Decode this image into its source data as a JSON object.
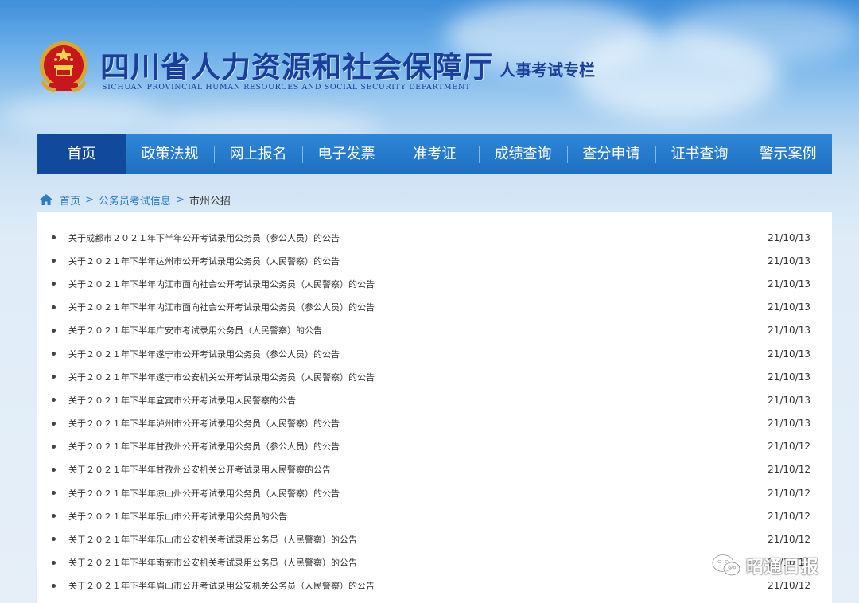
{
  "header": {
    "title": "四川省人力资源和社会保障厅",
    "subtitle": "SICHUAN PROVINCIAL HUMAN RESOURCES AND SOCIAL SECURITY DEPARTMENT",
    "section": "人事考试专栏",
    "emblem_icon": "national-emblem-icon"
  },
  "nav": {
    "items": [
      {
        "label": "首页"
      },
      {
        "label": "政策法规"
      },
      {
        "label": "网上报名"
      },
      {
        "label": "电子发票"
      },
      {
        "label": "准考证"
      },
      {
        "label": "成绩查询"
      },
      {
        "label": "查分申请"
      },
      {
        "label": "证书查询"
      },
      {
        "label": "警示案例"
      }
    ],
    "active_index": 0
  },
  "breadcrumb": {
    "home": "首页",
    "sep": ">",
    "parent": "公务员考试信息",
    "current": "市州公招"
  },
  "list": {
    "items": [
      {
        "title": "关于成都市２０２１年下半年公开考试录用公务员（参公人员）的公告",
        "date": "21/10/13"
      },
      {
        "title": "关于２０２１年下半年达州市公开考试录用公务员（人民警察）的公告",
        "date": "21/10/13"
      },
      {
        "title": "关于２０２１年下半年内江市面向社会公开考试录用公务员（人民警察）的公告",
        "date": "21/10/13"
      },
      {
        "title": "关于２０２１年下半年内江市面向社会公开考试录用公务员（参公人员）的公告",
        "date": "21/10/13"
      },
      {
        "title": "关于２０２１年下半年广安市考试录用公务员（人民警察）的公告",
        "date": "21/10/13"
      },
      {
        "title": "关于２０２１年下半年遂宁市公开考试录用公务员（参公人员）的公告",
        "date": "21/10/13"
      },
      {
        "title": "关于２０２１年下半年遂宁市公安机关公开考试录用公务员（人民警察）的公告",
        "date": "21/10/13"
      },
      {
        "title": "关于２０２１年下半年宜宾市公开考试录用人民警察的公告",
        "date": "21/10/13"
      },
      {
        "title": "关于２０２１年下半年泸州市公开考试录用公务员（人民警察）的公告",
        "date": "21/10/13"
      },
      {
        "title": "关于２０２１年下半年甘孜州公开考试录用公务员（参公人员）的公告",
        "date": "21/10/12"
      },
      {
        "title": "关于２０２１年下半年甘孜州公安机关公开考试录用人民警察的公告",
        "date": "21/10/12"
      },
      {
        "title": "关于２０２１年下半年凉山州公开考试录用公务员（人民警察）的公告",
        "date": "21/10/12"
      },
      {
        "title": "关于２０２１年下半年乐山市公开考试录用公务员的公告",
        "date": "21/10/12"
      },
      {
        "title": "关于２０２１年下半年乐山市公安机关考试录用公务员（人民警察）的公告",
        "date": "21/10/12"
      },
      {
        "title": "关于２０２１年下半年南充市公安机关考试录用公务员（人民警察）的公告",
        "date": "21/10/12"
      },
      {
        "title": "关于２０２１年下半年眉山市公开考试录用公安机关公务员（人民警察）的公告",
        "date": "21/10/12"
      }
    ]
  },
  "watermark": {
    "text": "昭通日报",
    "icon": "wechat-icon"
  },
  "colors": {
    "nav_bg": "#2379cb",
    "nav_active": "#114a9c",
    "title_blue": "#1a3f9a",
    "link_blue": "#2f7bc7"
  }
}
